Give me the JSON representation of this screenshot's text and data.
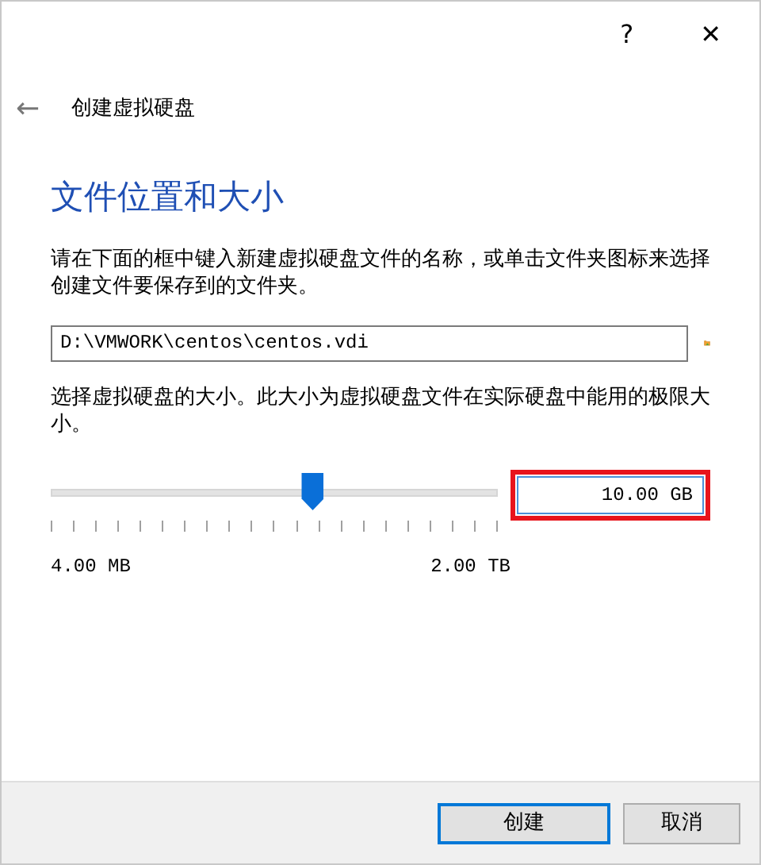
{
  "title_bar": {
    "help": "?",
    "close": "✕"
  },
  "header": {
    "back": "←",
    "title": "创建虚拟硬盘"
  },
  "heading": "文件位置和大小",
  "location_text": "请在下面的框中键入新建虚拟硬盘文件的名称，或单击文件夹图标来选择创建文件要保存到的文件夹。",
  "location_field": {
    "value": "D:\\VMWORK\\centos\\centos.vdi"
  },
  "size_text": "选择虚拟硬盘的大小。此大小为虚拟硬盘文件在实际硬盘中能用的极限大小。",
  "size_slider": {
    "level": 0.586,
    "min_label": "4.00 MB",
    "max_label": "2.00 TB"
  },
  "size_field": {
    "value": "10.00 GB",
    "highlighted": true
  },
  "buttons": [
    {
      "label": "创建",
      "default": true
    },
    {
      "label": "取消",
      "default": false
    }
  ]
}
